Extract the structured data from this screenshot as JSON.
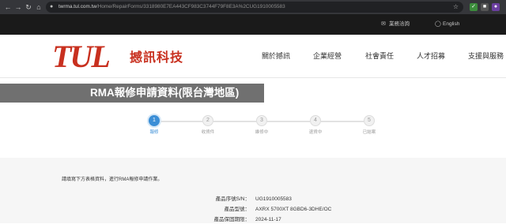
{
  "browser": {
    "url_host": "twrma.tul.com.tw",
    "url_path": "/Home/RepairForms/3318980E7EA443CF983C3744F79F8E3A%2CUG1910005583"
  },
  "utility_bar": {
    "contact": "業務洽詢",
    "language": "English"
  },
  "header": {
    "logo_mark": "TUL",
    "logo_text": "撼訊科技",
    "nav": [
      "關於撼訊",
      "企業經營",
      "社會責任",
      "人才招募",
      "支援與服務"
    ]
  },
  "page_title": "RMA報修申請資料(限台灣地區)",
  "steps": [
    {
      "number": "1",
      "label": "報修"
    },
    {
      "number": "2",
      "label": "收貨件"
    },
    {
      "number": "3",
      "label": "維修中"
    },
    {
      "number": "4",
      "label": "退貨中"
    },
    {
      "number": "5",
      "label": "已結案"
    }
  ],
  "active_step": 1,
  "form": {
    "instruction": "請填寫下方表格資料，進行RMA報修申請作業。",
    "fields": [
      {
        "label": "產品序號S/N：",
        "value": "UG1910005583"
      },
      {
        "label": "產品型號：",
        "value": "AXRX 5700XT 8GBD6-3DHE/OC"
      },
      {
        "label": "產品保固期限：",
        "value": "2024-11-17"
      }
    ]
  },
  "colors": {
    "brand_red": "#c8301f",
    "step_active": "#3b8ed6",
    "title_band": "#707070"
  }
}
